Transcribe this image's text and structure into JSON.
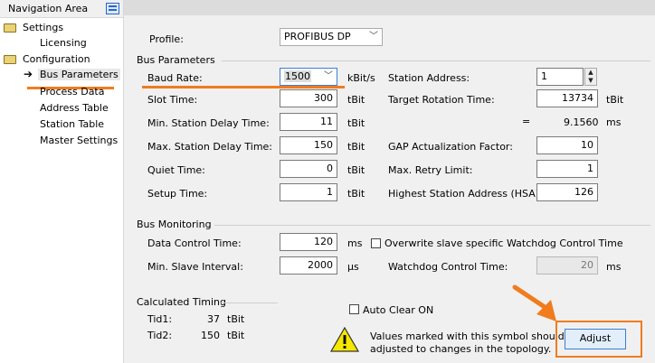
{
  "nav": {
    "title": "Navigation Area",
    "items": [
      {
        "label": "Settings"
      },
      {
        "label": "Licensing"
      },
      {
        "label": "Configuration"
      },
      {
        "label": "Bus Parameters"
      },
      {
        "label": "Process Data"
      },
      {
        "label": "Address Table"
      },
      {
        "label": "Station Table"
      },
      {
        "label": "Master Settings"
      }
    ]
  },
  "profile": {
    "label": "Profile:",
    "value": "PROFIBUS DP"
  },
  "bus_parameters": {
    "group_label": "Bus Parameters",
    "baud_rate": {
      "label": "Baud Rate:",
      "value": "1500",
      "unit": "kBit/s"
    },
    "slot_time": {
      "label": "Slot Time:",
      "value": "300",
      "unit": "tBit"
    },
    "min_station_delay": {
      "label": "Min. Station Delay Time:",
      "value": "11",
      "unit": "tBit"
    },
    "max_station_delay": {
      "label": "Max. Station Delay Time:",
      "value": "150",
      "unit": "tBit"
    },
    "quiet_time": {
      "label": "Quiet Time:",
      "value": "0",
      "unit": "tBit"
    },
    "setup_time": {
      "label": "Setup Time:",
      "value": "1",
      "unit": "tBit"
    },
    "station_address": {
      "label": "Station Address:",
      "value": "1"
    },
    "target_rotation": {
      "label": "Target Rotation Time:",
      "value": "13734",
      "unit": "tBit"
    },
    "equals": {
      "sign": "=",
      "value": "9.1560",
      "unit": "ms"
    },
    "gap_factor": {
      "label": "GAP Actualization Factor:",
      "value": "10"
    },
    "max_retry": {
      "label": "Max. Retry Limit:",
      "value": "1"
    },
    "hsa": {
      "label": "Highest Station Address (HSA):",
      "value": "126"
    }
  },
  "bus_monitoring": {
    "group_label": "Bus Monitoring",
    "data_control": {
      "label": "Data Control Time:",
      "value": "120",
      "unit": "ms"
    },
    "min_slave": {
      "label": "Min. Slave Interval:",
      "value": "2000",
      "unit": "µs"
    },
    "overwrite_label": "Overwrite slave specific Watchdog Control Time",
    "watchdog": {
      "label": "Watchdog Control Time:",
      "value": "20",
      "unit": "ms"
    }
  },
  "calculated_timing": {
    "group_label": "Calculated Timing",
    "tid1": {
      "label": "Tid1:",
      "value": "37",
      "unit": "tBit"
    },
    "tid2": {
      "label": "Tid2:",
      "value": "150",
      "unit": "tBit"
    }
  },
  "auto_clear_label": "Auto Clear ON",
  "note": {
    "line1": "Values marked with this symbol should be",
    "line2": "adjusted to changes in the topology."
  },
  "adjust_label": "Adjust",
  "colors": {
    "highlight": "#f07c1e",
    "warning": "#f5e700"
  }
}
